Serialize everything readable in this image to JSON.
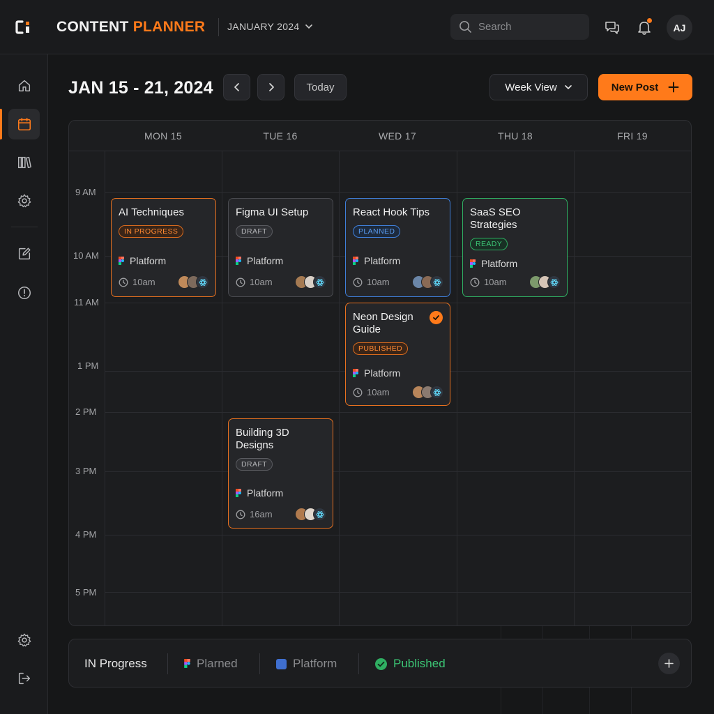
{
  "app": {
    "title_main": "CONTENT ",
    "title_accent": "PLANNER",
    "month_label": "JANUARY 2024",
    "accent_color": "#ff7a1a"
  },
  "topbar": {
    "search_placeholder": "Search",
    "icons": [
      "search-icon",
      "chat-icon",
      "bell-icon"
    ],
    "user_initials": "AJ"
  },
  "sidebar": {
    "items": [
      "home-icon",
      "calendar-icon",
      "library-icon",
      "settings-icon",
      "edit-icon",
      "info-icon"
    ],
    "bottom_items": [
      "settings-icon",
      "logout-icon"
    ],
    "active": "calendar-icon"
  },
  "header": {
    "range": "JAN 15 - 21, 2024",
    "today_label": "Today",
    "view_label": "Week View",
    "new_post_label": "New Post"
  },
  "calendar": {
    "days": [
      "MON 15",
      "TUE 16",
      "WED 17",
      "THU 18",
      "FRI 19"
    ],
    "times": [
      "9 AM",
      "10 AM",
      "11 AM",
      "1 PM",
      "2 PM",
      "3 PM",
      "4 PM",
      "5 PM"
    ],
    "events": [
      {
        "title": "AI Techniques",
        "status": "IN PROGRESS",
        "platform": "Platform",
        "time": "10am",
        "color": "orange"
      },
      {
        "title": "Figma UI Setup",
        "status": "DRAFT",
        "platform": "Platform",
        "time": "10am",
        "color": "gray"
      },
      {
        "title": "React Hook Tips",
        "status": "PLANNED",
        "platform": "Platform",
        "time": "10am",
        "color": "blue"
      },
      {
        "title": "SaaS SEO Strategies",
        "status": "READY",
        "platform": "Platform",
        "time": "10am",
        "color": "green"
      },
      {
        "title": "Neon Design Guide",
        "status": "PUBLISHED",
        "platform": "Platform",
        "time": "10am",
        "color": "orange"
      },
      {
        "title": "Building 3D Designs",
        "status": "DRAFT",
        "platform": "Platform",
        "time": "16am",
        "color": "orange"
      }
    ]
  },
  "legend": {
    "items": [
      {
        "label": "IN Progress",
        "color": "#e8e8e8"
      },
      {
        "label": "Plarned",
        "color": "#8a8b8e"
      },
      {
        "label": "Platform",
        "color": "#8a8b8e"
      },
      {
        "label": "Published",
        "color": "#3cc675"
      }
    ]
  }
}
